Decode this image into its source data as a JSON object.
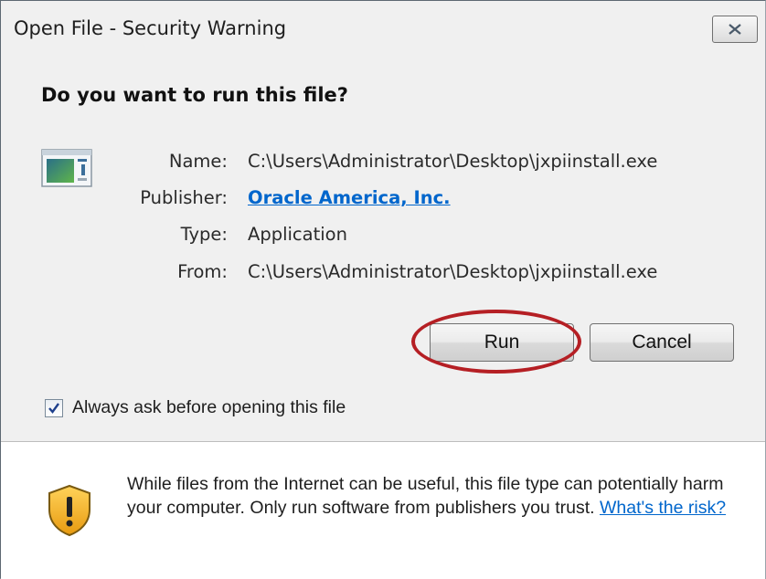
{
  "window": {
    "title": "Open File - Security Warning"
  },
  "dialog": {
    "heading": "Do you want to run this file?",
    "fields": [
      {
        "label": "Name:",
        "value": "C:\\Users\\Administrator\\Desktop\\jxpiinstall.exe"
      },
      {
        "label": "Publisher:",
        "value": "Oracle America, Inc."
      },
      {
        "label": "Type:",
        "value": "Application"
      },
      {
        "label": "From:",
        "value": "C:\\Users\\Administrator\\Desktop\\jxpiinstall.exe"
      }
    ]
  },
  "buttons": {
    "run_label": "Run",
    "cancel_label": "Cancel"
  },
  "checkbox": {
    "label": "Always ask before opening this file",
    "checked": true
  },
  "footer": {
    "warning_text": "While files from the Internet can be useful, this file type can potentially harm your computer. Only run software from publishers you trust.",
    "risk_link": "What's the risk?"
  },
  "icons": {
    "close": "close-icon",
    "application": "application-icon",
    "shield": "shield-warning-icon",
    "check": "checkmark-icon"
  },
  "colors": {
    "link": "#0066cc",
    "highlight_ring": "#b51f24",
    "shield_yellow": "#f2b01e"
  }
}
